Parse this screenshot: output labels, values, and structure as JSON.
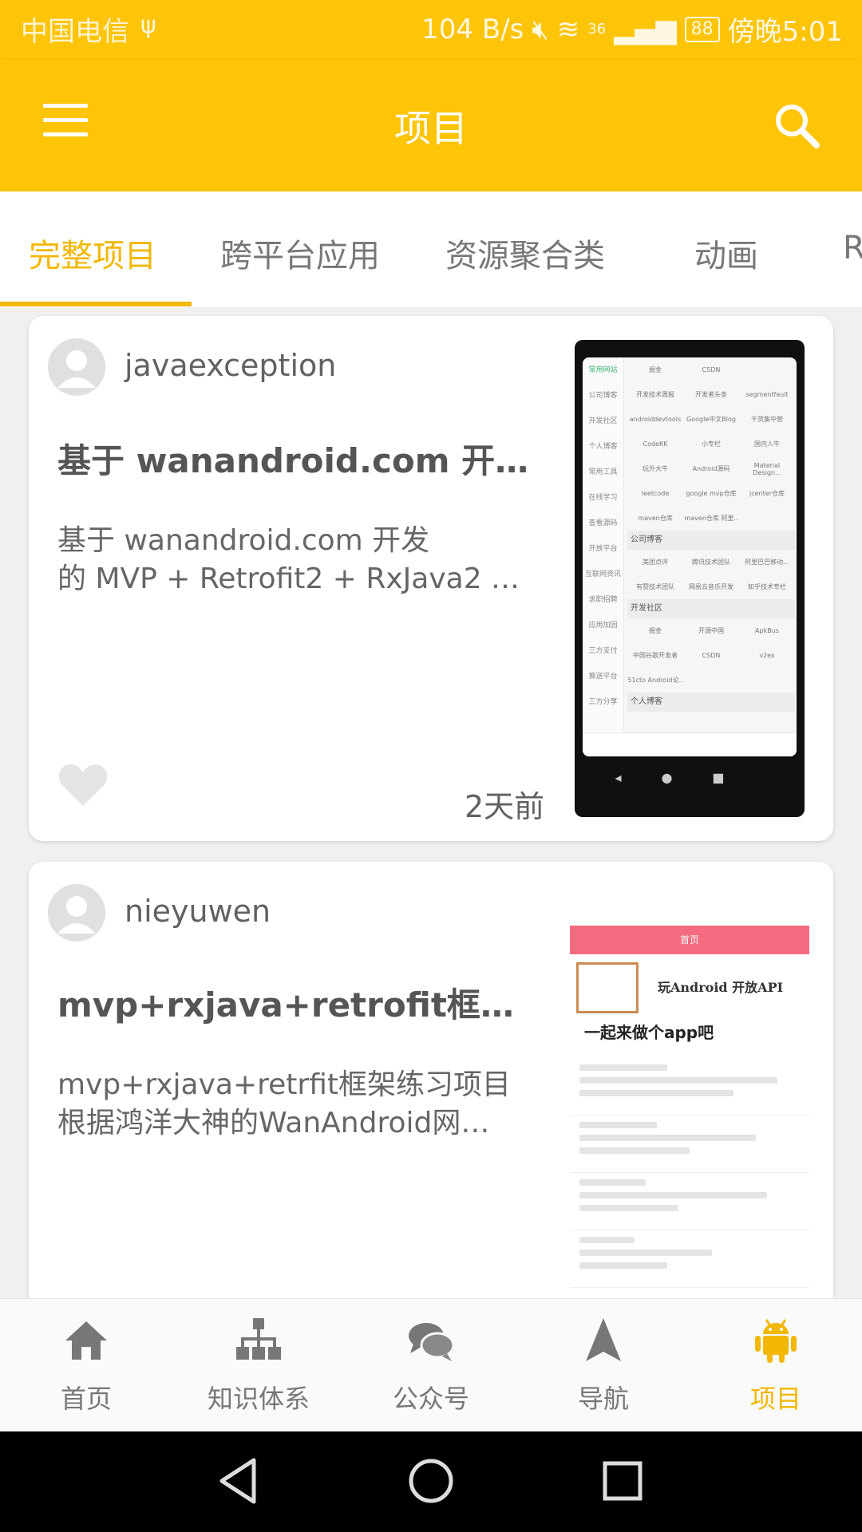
{
  "status_bar": {
    "carrier": "中国电信",
    "speed": "104 B/s",
    "signal": "36",
    "battery": "88",
    "time": "傍晚5:01"
  },
  "app_bar": {
    "title": "项目"
  },
  "tabs": [
    {
      "label": "完整项目",
      "active": true
    },
    {
      "label": "跨平台应用"
    },
    {
      "label": "资源聚合类"
    },
    {
      "label": "动画"
    },
    {
      "label": "R"
    }
  ],
  "cards": [
    {
      "author": "javaexception",
      "title": "基于 wanandroid.com 开…",
      "desc_lines": [
        "基于 wanandroid.com 开发",
        "的 MVP + Retrofit2 + RxJava2 …"
      ],
      "time": "2天前"
    },
    {
      "author": "nieyuwen",
      "title": "mvp+rxjava+retrofit框架练…",
      "desc_lines": [
        "mvp+rxjava+retrfit框架练习项目",
        "根据鸿洋大神的WanAndroid网…"
      ]
    }
  ],
  "thumb1": {
    "side": [
      "常用网站",
      "公司博客",
      "开发社区",
      "个人博客",
      "常用工具",
      "在线学习",
      "查看源码",
      "开放平台",
      "互联网资讯",
      "求职招聘",
      "应用加固",
      "三方支付",
      "推送平台",
      "三方分享"
    ],
    "rows": [
      [
        "掘金",
        "CSDN",
        ""
      ],
      [
        "开发技术周报",
        "开发者头条",
        "segmentfault"
      ],
      [
        "androiddevtools",
        "Google中文Blog",
        "干货集中营"
      ],
      [
        "CodeKK",
        "小专栏",
        "国内人牛"
      ],
      [
        "玩外大牛",
        "Android源码",
        "Material Design..."
      ],
      [
        "leetcode",
        "google mvp仓库",
        "jcenter仓库"
      ],
      [
        "maven仓库",
        "maven仓库 阿里..",
        ""
      ]
    ],
    "sec1": "公司博客",
    "rows2": [
      [
        "美团点评",
        "腾讯技术团队",
        "阿里巴巴移动..."
      ],
      [
        "有赞技术团队",
        "网易云音乐开发",
        "知乎技术专栏"
      ]
    ],
    "sec2": "开发社区",
    "rows3": [
      [
        "掘金",
        "开源中国",
        "ApkBus"
      ],
      [
        "中国谷歌开发者",
        "CSDN",
        "v2ex"
      ],
      [
        "51cto Android论..",
        "",
        ""
      ]
    ],
    "sec3": "个人博客"
  },
  "thumb2": {
    "header": "首页",
    "banner_line1": "玩Android 开放API",
    "banner_line2": "一起来做个app吧"
  },
  "bottom_nav": [
    {
      "label": "首页",
      "icon": "home-icon"
    },
    {
      "label": "知识体系",
      "icon": "hierarchy-icon"
    },
    {
      "label": "公众号",
      "icon": "chat-icon"
    },
    {
      "label": "导航",
      "icon": "navigation-icon"
    },
    {
      "label": "项目",
      "icon": "android-icon",
      "active": true
    }
  ],
  "colors": {
    "primary": "#fdc408",
    "accent": "#f2b705"
  }
}
